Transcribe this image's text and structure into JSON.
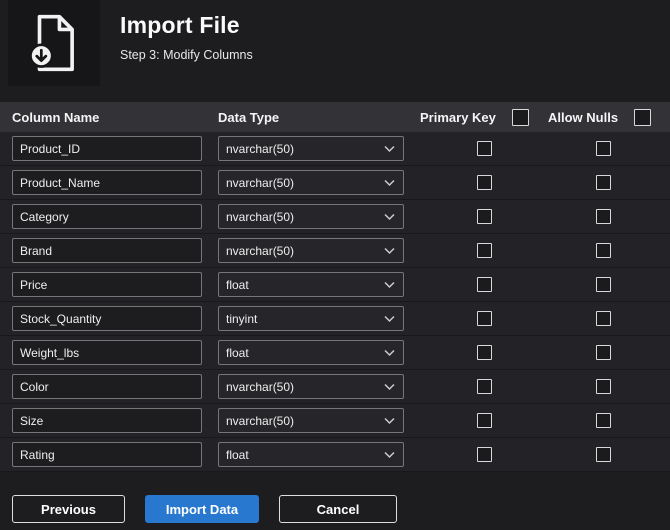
{
  "header": {
    "title": "Import File",
    "subtitle": "Step 3: Modify Columns"
  },
  "table": {
    "headers": {
      "column_name": "Column Name",
      "data_type": "Data Type",
      "primary_key": "Primary Key",
      "allow_nulls": "Allow Nulls"
    },
    "rows": [
      {
        "name": "Product_ID",
        "type": "nvarchar(50)"
      },
      {
        "name": "Product_Name",
        "type": "nvarchar(50)"
      },
      {
        "name": "Category",
        "type": "nvarchar(50)"
      },
      {
        "name": "Brand",
        "type": "nvarchar(50)"
      },
      {
        "name": "Price",
        "type": "float"
      },
      {
        "name": "Stock_Quantity",
        "type": "tinyint"
      },
      {
        "name": "Weight_lbs",
        "type": "float"
      },
      {
        "name": "Color",
        "type": "nvarchar(50)"
      },
      {
        "name": "Size",
        "type": "nvarchar(50)"
      },
      {
        "name": "Rating",
        "type": "float"
      }
    ]
  },
  "buttons": {
    "previous": "Previous",
    "import_data": "Import Data",
    "cancel": "Cancel"
  },
  "colors": {
    "background": "#1d1d1f",
    "table_header": "#323237",
    "accent_blue": "#2878d0"
  },
  "icons": {
    "file_import": "document-with-download-arrow-circle",
    "dropdown": "chevron-down"
  }
}
